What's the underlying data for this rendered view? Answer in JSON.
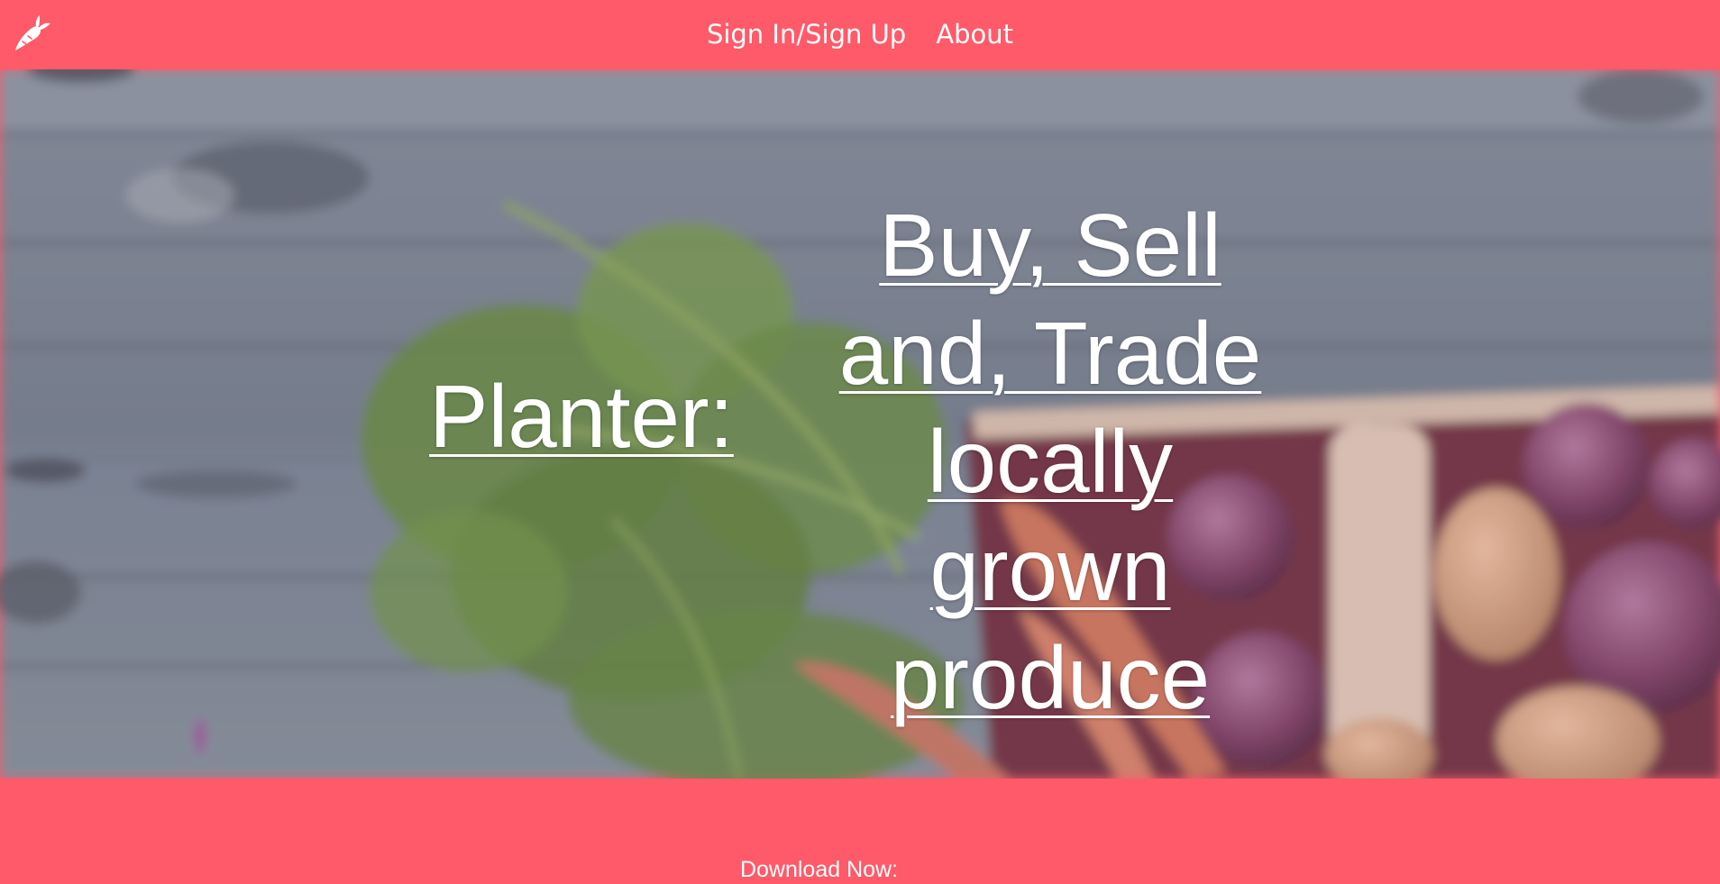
{
  "header": {
    "logo_icon": "carrot-icon",
    "nav": [
      {
        "label": "Sign In/Sign Up"
      },
      {
        "label": "About"
      }
    ]
  },
  "hero": {
    "brand": "Planter:",
    "tagline": "Buy, Sell and, Trade locally grown produce",
    "background": "blurred photo of carrots and onions in a wooden basket on grey planks"
  },
  "footer": {
    "download_label": "Download Now:"
  },
  "colors": {
    "brand": "#fe5a69",
    "text": "#ffffff"
  }
}
